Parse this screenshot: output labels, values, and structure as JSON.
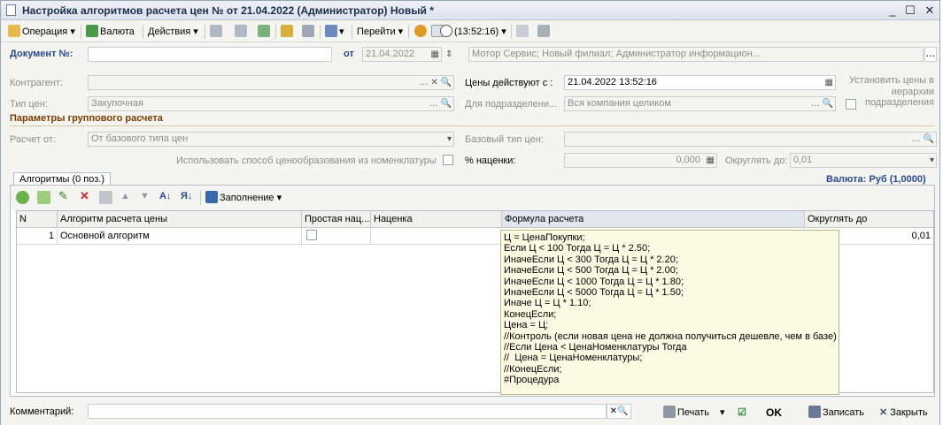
{
  "window": {
    "title": "Настройка алгоритмов расчета цен №  от 21.04.2022 (Администратор) Новый *"
  },
  "toolbar": {
    "operation": "Операция",
    "currency": "Валюта",
    "actions": "Действия",
    "goto": "Перейти",
    "time": "(13:52:16)"
  },
  "header": {
    "doc_label": "Документ №:",
    "doc_value": "",
    "from_label": "от",
    "date": "21.04.2022",
    "org": "Мотор Сервис; Новый филиал; Администратор информацион..."
  },
  "form": {
    "counterparty_label": "Контрагент:",
    "counterparty_value": "",
    "price_type_label": "Тип цен:",
    "price_type_value": "Закупочная",
    "prices_valid_label": "Цены действуют с :",
    "prices_valid_value": "21.04.2022 13:52:16",
    "subdivision_label": "Для подразделени...",
    "subdivision_value": "Вся компания целиком",
    "hierarchy_label": "Установить цены в иерархии подразделения",
    "group_section": "Параметры группового расчета",
    "calc_from_label": "Расчет от:",
    "calc_from_value": "От базового типа цен",
    "base_type_label": "Базовый тип цен:",
    "base_type_value": "",
    "use_method_label": "Использовать способ ценообразования из номенклатуры",
    "markup_label": "% наценки:",
    "markup_value": "0,000",
    "round_label": "Округлять до:",
    "round_value": "0,01"
  },
  "tab": {
    "label": "Алгоритмы (0 поз.)",
    "fill": "Заполнение",
    "currency_note": "Валюта: Руб (1,0000)"
  },
  "grid": {
    "headers": [
      "N",
      "Алгоритм расчета цены",
      "Простая нац...",
      "Наценка",
      "Формула расчета",
      "Округлять до"
    ],
    "row": {
      "n": "1",
      "name": "Основной алгоритм",
      "markup": "",
      "round": "0,01"
    }
  },
  "formula": "Ц = ЦенаПокупки;\nЕсли Ц < 100 Тогда Ц = Ц * 2.50;\nИначеЕсли Ц < 300 Тогда Ц = Ц * 2.20;\nИначеЕсли Ц < 500 Тогда Ц = Ц * 2.00;\nИначеЕсли Ц < 1000 Тогда Ц = Ц * 1.80;\nИначеЕсли Ц < 5000 Тогда Ц = Ц * 1.50;\nИначе Ц = Ц * 1.10;\nКонецЕсли;\nЦена = Ц;\n//Контроль (если новая цена не должна получиться дешевле, чем в базе)\n//Если Цена < ЦенаНоменклатуры Тогда\n//  Цена = ЦенаНоменклатуры;\n//КонецЕсли;\n#Процедура",
  "footer": {
    "comment_label": "Комментарий:",
    "comment_value": "",
    "print": "Печать",
    "ok": "OK",
    "save": "Записать",
    "close": "Закрыть"
  },
  "colors": {
    "accent_blue": "#2a4a8c",
    "section": "#7a3b00",
    "tooltip_bg": "#fbfbe3"
  }
}
